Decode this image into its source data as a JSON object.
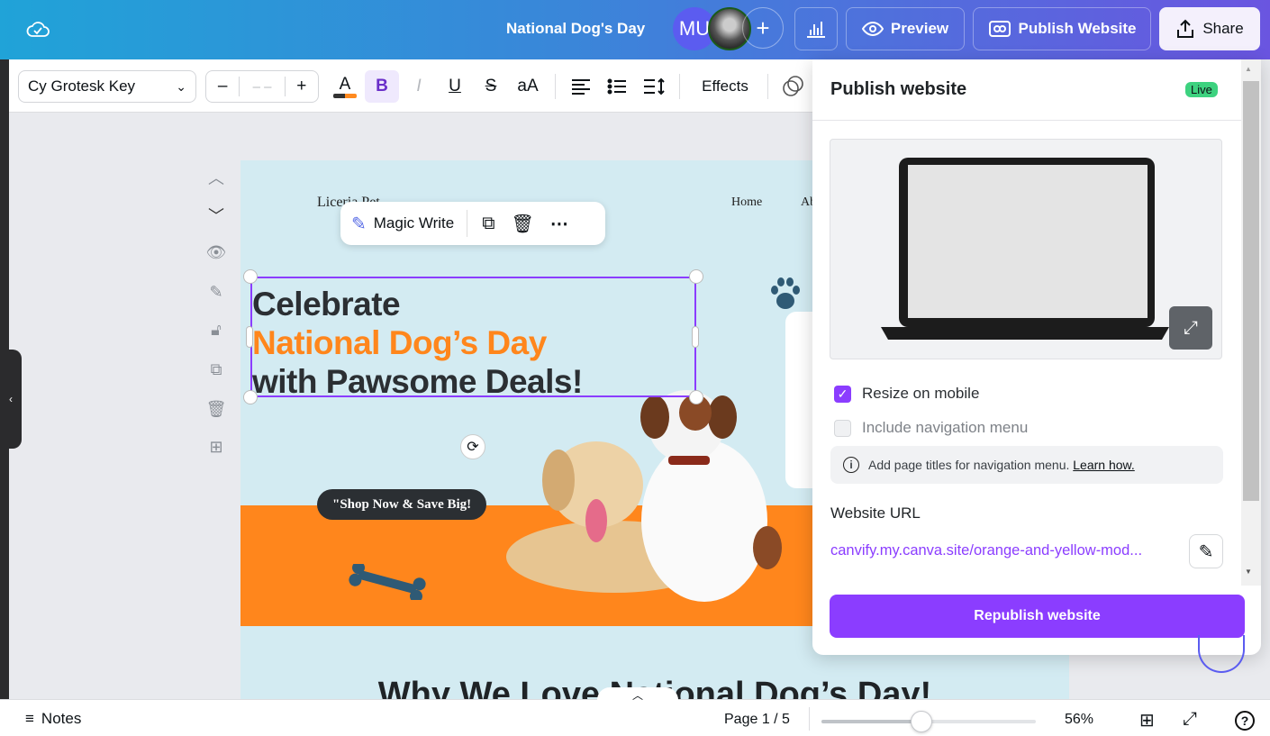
{
  "topbar": {
    "doc_title": "National Dog's Day",
    "avatar_initials": "MU",
    "add_label": "+",
    "preview_label": "Preview",
    "publish_label": "Publish Website",
    "share_label": "Share"
  },
  "toolbar": {
    "font_name": "Cy Grotesk Key",
    "font_size": "– –",
    "minus": "–",
    "plus": "+",
    "text_color": "A",
    "bold": "B",
    "italic": "I",
    "underline": "U",
    "strike": "S",
    "case": "aA",
    "effects_label": "Effects"
  },
  "floating_menu": {
    "magic_write_label": "Magic Write"
  },
  "page": {
    "brand": "Liceria Pet",
    "nav": [
      "Home",
      "Ab"
    ],
    "headline_line1": "Celebrate",
    "headline_line2": "National Dog’s Day",
    "headline_line3": "with Pawsome Deals!",
    "cta": "\"Shop Now & Save Big!",
    "section_title": "Why We Love National Dog’s Day!"
  },
  "panel": {
    "title": "Publish website",
    "status_badge": "Live",
    "resize_label": "Resize on mobile",
    "resize_checked": true,
    "nav_menu_label": "Include navigation menu",
    "nav_menu_checked": false,
    "info_text": "Add page titles for navigation menu.",
    "info_link": "Learn how.",
    "url_label": "Website URL",
    "url_value": "canvify.my.canva.site/orange-and-yellow-mod...",
    "republish_label": "Republish website"
  },
  "bottombar": {
    "notes_label": "Notes",
    "page_indicator": "Page 1 / 5",
    "zoom_percent": "56%",
    "zoom_level": 56
  },
  "colors": {
    "accent": "#8b3dff",
    "orange": "#ff8a1f",
    "live": "#3dd27f",
    "dark_text": "#2b2f33"
  }
}
